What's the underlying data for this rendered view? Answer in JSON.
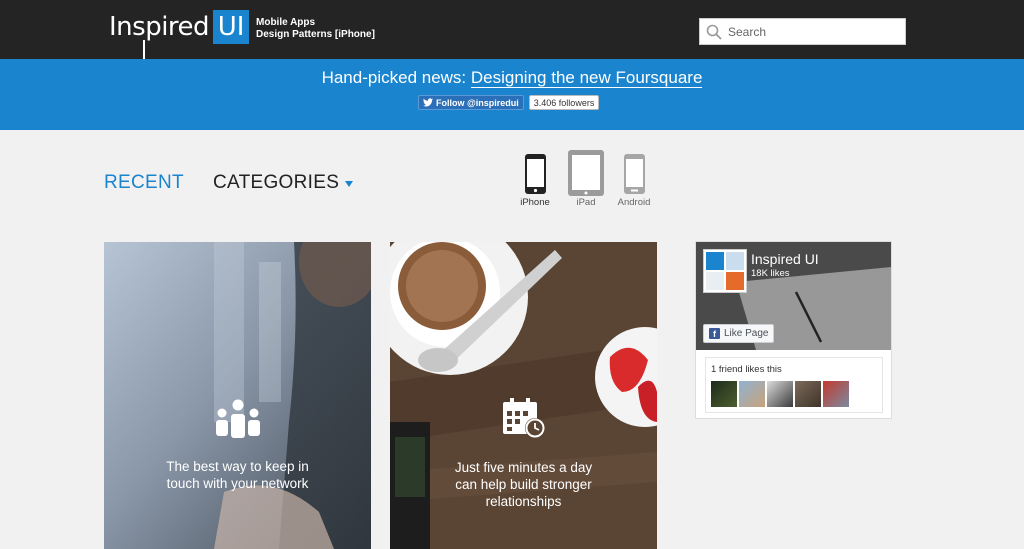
{
  "header": {
    "logo_word": "Inspired",
    "logo_badge": "UI",
    "tagline_line1": "Mobile Apps",
    "tagline_line2": "Design Patterns [iPhone]",
    "search_placeholder": "Search"
  },
  "newsbar": {
    "prefix": "Hand-picked news:",
    "link_text": "Designing the new Foursquare",
    "follow_label": "Follow @inspiredui",
    "followers": "3.406 followers"
  },
  "nav": {
    "recent": "RECENT",
    "categories": "CATEGORIES"
  },
  "devices": [
    {
      "label": "iPhone",
      "icon": "iphone-icon",
      "active": true
    },
    {
      "label": "iPad",
      "icon": "ipad-icon",
      "active": false
    },
    {
      "label": "Android",
      "icon": "android-phone-icon",
      "active": false
    }
  ],
  "cards": [
    {
      "text_line1": "The best way to keep in",
      "text_line2": "touch with your network",
      "icon": "people-group-icon"
    },
    {
      "text_line1": "Just five minutes a day",
      "text_line2": "can help build stronger",
      "text_line3": "relationships",
      "icon": "calendar-clock-icon"
    }
  ],
  "facebook": {
    "page_name": "Inspired UI",
    "likes": "18K likes",
    "like_button": "Like Page",
    "friends_text": "1 friend likes this"
  },
  "colors": {
    "brand_blue": "#1a84cf",
    "header_bg": "#242424",
    "facebook_blue": "#3b5998"
  }
}
